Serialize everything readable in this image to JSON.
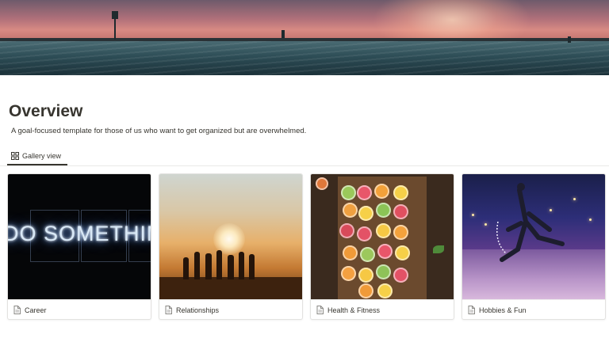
{
  "page": {
    "title": "Overview",
    "description": "A goal-focused template for those of us who want to get organized but are overwhelmed."
  },
  "view_tab": {
    "label": "Gallery view",
    "icon": "gallery-grid-icon"
  },
  "gallery": {
    "cards": [
      {
        "label": "Career",
        "icon": "page-icon",
        "image_text": "DO SOMETHING GREAT"
      },
      {
        "label": "Relationships",
        "icon": "page-icon"
      },
      {
        "label": "Health & Fitness",
        "icon": "page-icon"
      },
      {
        "label": "Hobbies & Fun",
        "icon": "page-icon"
      }
    ]
  },
  "colors": {
    "text": "#37352f",
    "border": "#e3e2e0",
    "background": "#ffffff"
  }
}
